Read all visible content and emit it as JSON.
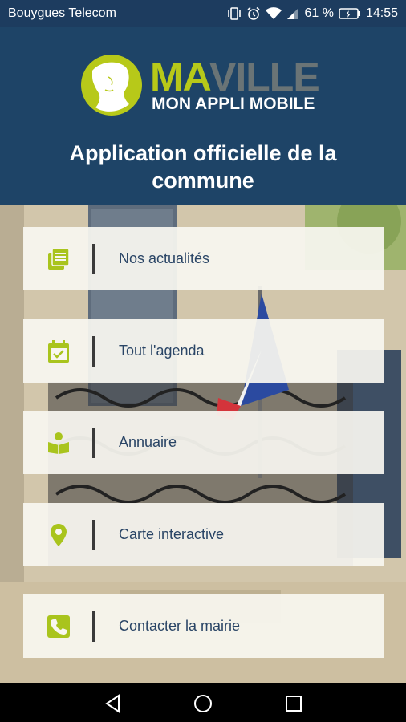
{
  "status_bar": {
    "carrier": "Bouygues Telecom",
    "battery_percent": "61 %",
    "time": "14:55"
  },
  "header": {
    "logo_ma": "MA",
    "logo_ville": "VILLE",
    "logo_tagline": "MON APPLI MOBILE",
    "title_line1": "Application officielle de la",
    "title_line2": "commune"
  },
  "menu": {
    "items": [
      {
        "label": "Nos actualités",
        "icon": "news-icon"
      },
      {
        "label": "Tout l'agenda",
        "icon": "calendar-icon"
      },
      {
        "label": "Annuaire",
        "icon": "directory-icon"
      },
      {
        "label": "Carte interactive",
        "icon": "map-pin-icon"
      },
      {
        "label": "Contacter la mairie",
        "icon": "phone-icon"
      }
    ]
  },
  "colors": {
    "header_bg": "#1e4467",
    "accent_green": "#b7c919",
    "label_text": "#2a4566"
  },
  "nav_bar": {
    "buttons": [
      "back-icon",
      "home-icon",
      "recent-apps-icon"
    ]
  }
}
